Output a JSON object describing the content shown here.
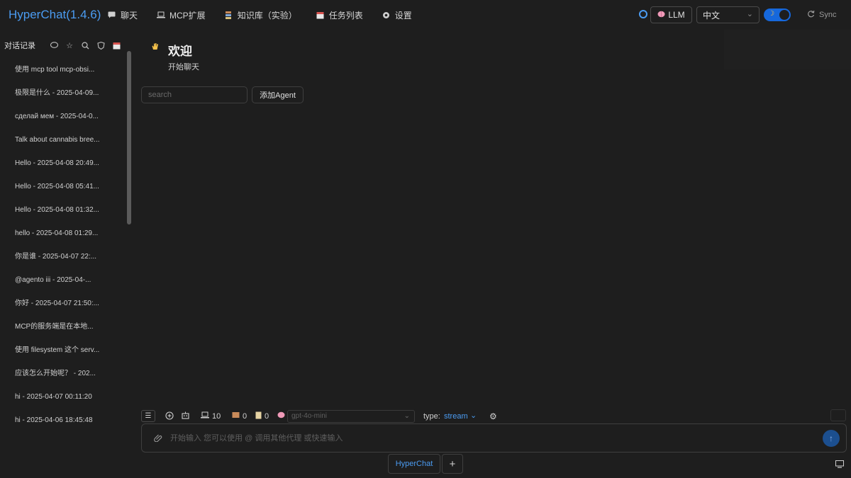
{
  "app": {
    "title": "HyperChat(1.4.6)"
  },
  "nav": [
    {
      "icon": "chat-bubble-icon",
      "label": "聊天"
    },
    {
      "icon": "laptop-icon",
      "label": "MCP扩展"
    },
    {
      "icon": "books-icon",
      "label": "知识库（实验）"
    },
    {
      "icon": "calendar-icon",
      "label": "任务列表"
    },
    {
      "icon": "gear-icon",
      "label": "设置"
    }
  ],
  "header_right": {
    "llm_label": "LLM",
    "language": "中文",
    "sync_label": "Sync"
  },
  "sidebar": {
    "title": "对话记录",
    "conversations": [
      "使用 mcp tool mcp-obsi...",
      "极限是什么 - 2025-04-09...",
      "сделай мем - 2025-04-0...",
      "Talk about cannabis bree...",
      "Hello - 2025-04-08 20:49...",
      "Hello - 2025-04-08 05:41...",
      "Hello - 2025-04-08 01:32...",
      "hello - 2025-04-08 01:29...",
      "你是谁 - 2025-04-07 22:...",
      "@agento iii - 2025-04-...",
      "你好 - 2025-04-07 21:50:...",
      "MCP的服务端是在本地...",
      "使用 filesystem 这个 serv...",
      "应该怎么开始呢？ - 202...",
      "hi - 2025-04-07 00:11:20",
      "hi - 2025-04-06 18:45:48"
    ]
  },
  "main": {
    "welcome_title": "欢迎",
    "welcome_subtitle": "开始聊天",
    "search_placeholder": "search",
    "add_agent_label": "添加Agent"
  },
  "toolbar": {
    "tools_count": "10",
    "resources_count": "0",
    "prompts_count": "0",
    "model_placeholder": "gpt-4o-mini",
    "type_label": "type:",
    "type_value": "stream"
  },
  "chat_input": {
    "placeholder": "开始输入 您可以使用 @ 调用其他代理 或快速输入"
  },
  "bottom_tabs": {
    "active_tab": "HyperChat",
    "add_label": "+"
  },
  "colors": {
    "accent": "#4b9cf2",
    "background": "#1e1e1e",
    "toggle": "#1668dc"
  }
}
